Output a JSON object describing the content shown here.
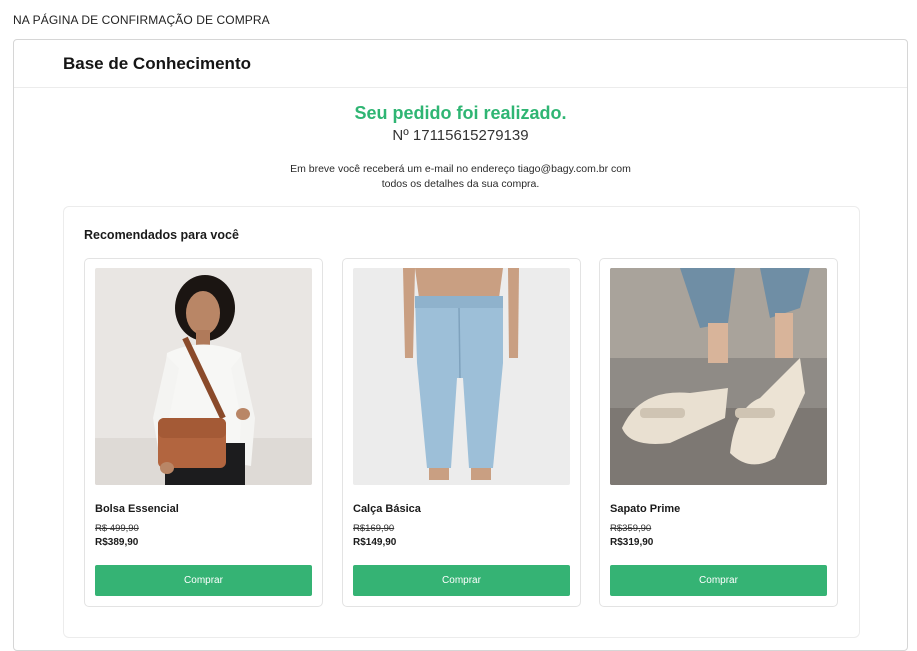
{
  "caption": "NA PÁGINA DE CONFIRMAÇÃO DE COMPRA",
  "header": {
    "title": "Base de Conhecimento"
  },
  "confirmation": {
    "title": "Seu pedido foi realizado.",
    "order_number": "Nº 17115615279139",
    "message_line1": "Em breve você receberá um e-mail no endereço tiago@bagy.com.br com",
    "message_line2": "todos os detalhes da sua compra."
  },
  "recommendations": {
    "title": "Recomendados para você",
    "products": [
      {
        "name": "Bolsa Essencial",
        "old_price": "R$ 499,90",
        "price": "R$389,90",
        "button": "Comprar",
        "image": "woman-with-brown-bag"
      },
      {
        "name": "Calça Básica",
        "old_price": "R$169,90",
        "price": "R$149,90",
        "button": "Comprar",
        "image": "light-blue-jeans"
      },
      {
        "name": "Sapato Prime",
        "old_price": "R$359,90",
        "price": "R$319,90",
        "button": "Comprar",
        "image": "beige-loafer-shoes"
      }
    ]
  },
  "colors": {
    "success": "#2fb573",
    "button": "#35b374"
  }
}
